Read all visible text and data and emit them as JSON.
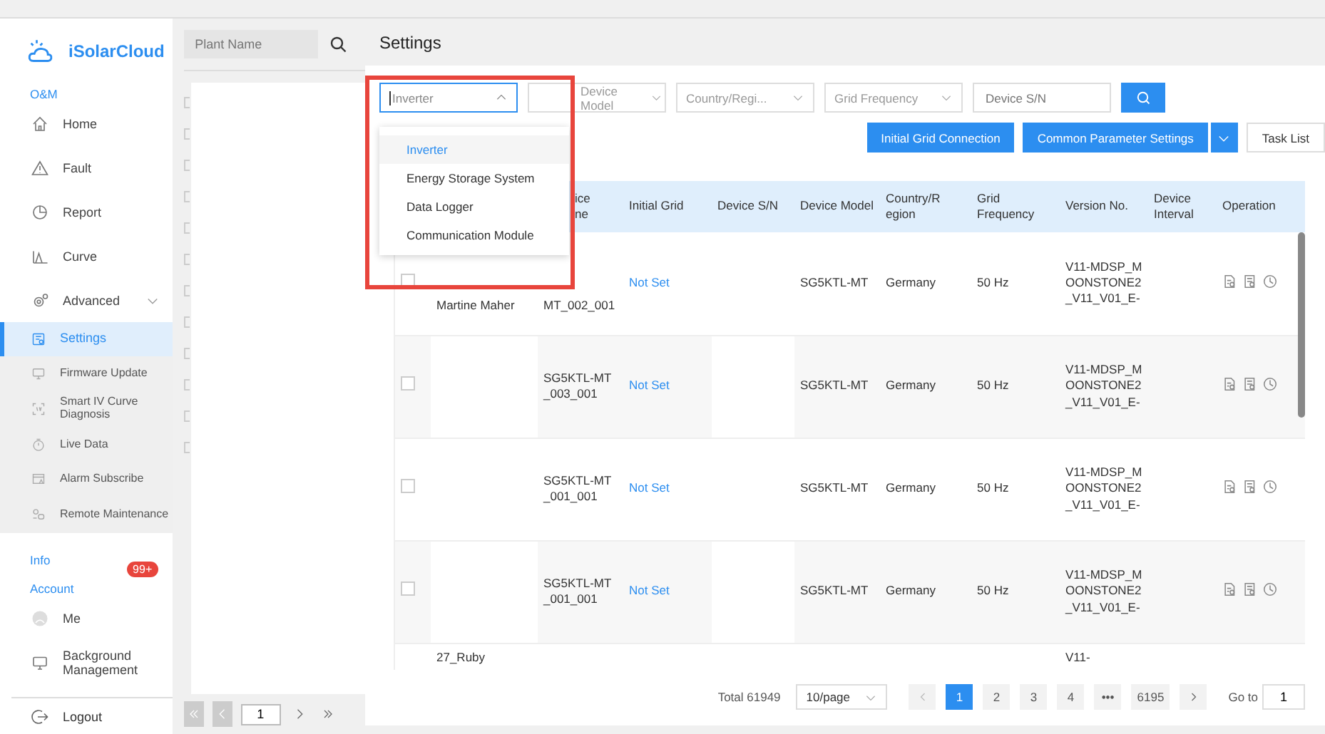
{
  "sidebar": {
    "logo": "iSolarCloud",
    "sections": [
      {
        "title": "O&M",
        "items": [
          {
            "label": "Home",
            "selected": false
          },
          {
            "label": "Fault",
            "selected": false
          },
          {
            "label": "Report",
            "selected": false
          },
          {
            "label": "Curve",
            "selected": false
          },
          {
            "label": "Advanced",
            "selected": false,
            "expanded": true,
            "children": [
              {
                "label": "Settings",
                "selected": true
              },
              {
                "label": "Firmware Update",
                "selected": false
              },
              {
                "label": "Smart IV Curve Diagnosis",
                "selected": false
              },
              {
                "label": "Live Data",
                "selected": false
              },
              {
                "label": "Alarm Subscribe",
                "selected": false
              },
              {
                "label": "Remote Maintenance",
                "selected": false
              }
            ]
          }
        ]
      },
      {
        "title": "Info",
        "badge": "99+"
      },
      {
        "title": "Account",
        "items": [
          {
            "label": "Me",
            "selected": false
          },
          {
            "label": "Background Management",
            "selected": false
          }
        ]
      }
    ],
    "logout": "Logout"
  },
  "plant_panel": {
    "search": {
      "placeholder": "Plant Name"
    },
    "pager": {
      "value": "1"
    }
  },
  "page_title": "Settings",
  "filters": [
    {
      "kind": "select",
      "value": "Inverter",
      "expanded": true
    },
    {
      "kind": "select",
      "placeholder": "Device Model",
      "expanded": false
    },
    {
      "kind": "select",
      "placeholder": "Country/Regi...",
      "expanded": false
    },
    {
      "kind": "select",
      "placeholder": "Grid Frequency",
      "expanded": false
    },
    {
      "kind": "input",
      "placeholder": "Device S/N"
    }
  ],
  "dropdown": {
    "options": [
      {
        "label": "Inverter",
        "selected": true
      },
      {
        "label": "Energy Storage System",
        "selected": false
      },
      {
        "label": "Data Logger",
        "selected": false
      },
      {
        "label": "Communication Module",
        "selected": false
      }
    ]
  },
  "actions": [
    {
      "label": "Initial Grid Connection",
      "kind": "primary"
    },
    {
      "label": "Common Parameter Settings",
      "kind": "split"
    },
    {
      "label": "Task List",
      "kind": "plain"
    }
  ],
  "table": {
    "columns": [
      "",
      "",
      "ice ne",
      "Initial Grid",
      "Device S/N",
      "Device Model",
      "Country/R egion",
      "Grid Frequency",
      "Version No.",
      "Device Interval",
      "Operation"
    ],
    "rows": [
      {
        "kind": "full",
        "checked": false,
        "name": "Martine Maher",
        "device_name": "MT_002_001",
        "initial_grid": "Not Set",
        "model": "SG5KTL-MT",
        "country": "Germany",
        "frequency": "50 Hz",
        "version": "V11-MDSP_MOONSTONE2_V11_V01_E-"
      },
      {
        "kind": "full",
        "checked": false,
        "device_name": "SG5KTL-MT_003_001",
        "initial_grid": "Not Set",
        "model": "SG5KTL-MT",
        "country": "Germany",
        "frequency": "50 Hz",
        "version": "V11-MDSP_MOONSTONE2_V11_V01_E-"
      },
      {
        "kind": "full",
        "checked": false,
        "device_name": "SG5KTL-MT_001_001",
        "initial_grid": "Not Set",
        "model": "SG5KTL-MT",
        "country": "Germany",
        "frequency": "50 Hz",
        "version": "V11-MDSP_MOONSTONE2_V11_V01_E-"
      },
      {
        "kind": "full",
        "checked": false,
        "device_name": "SG5KTL-MT_001_001",
        "initial_grid": "Not Set",
        "model": "SG5KTL-MT",
        "country": "Germany",
        "frequency": "50 Hz",
        "version": "V11-MDSP_MOONSTONE2_V11_V01_E-"
      },
      {
        "kind": "partial",
        "name": "27_Ruby",
        "version": "V11-"
      }
    ]
  },
  "pagination": {
    "total": "Total 61949",
    "page_size": "10/page",
    "pages": [
      {
        "label": "1",
        "selected": true
      },
      {
        "label": "2",
        "selected": false
      },
      {
        "label": "3",
        "selected": false
      },
      {
        "label": "4",
        "selected": false
      },
      {
        "label": "•••",
        "selected": false
      },
      {
        "label": "6195",
        "selected": false
      }
    ],
    "goto_label": "Go to",
    "goto_value": "1"
  }
}
